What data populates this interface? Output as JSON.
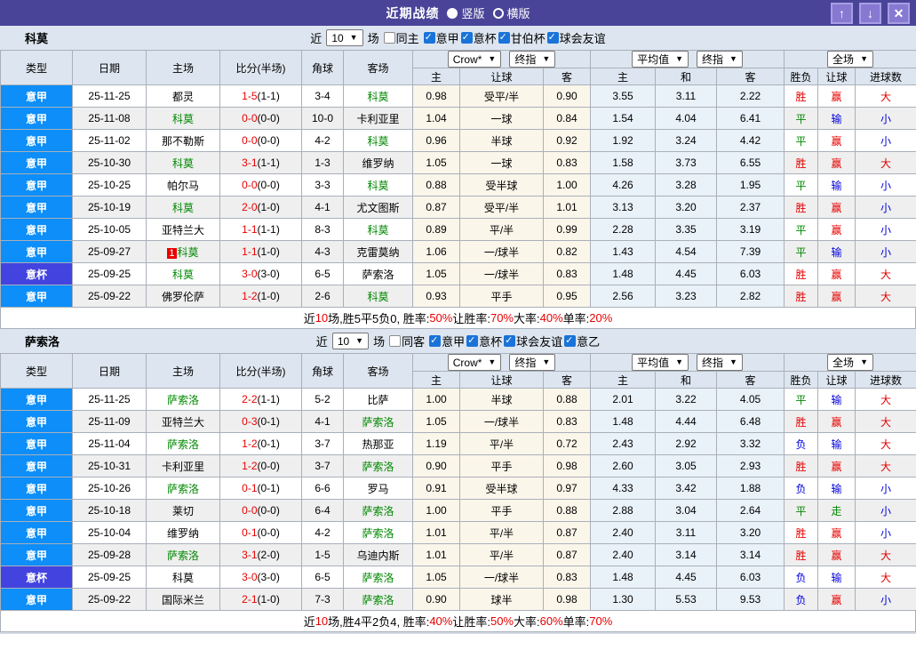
{
  "titlebar": {
    "title": "近期战绩",
    "layout_options": [
      {
        "label": "竖版",
        "selected": true
      },
      {
        "label": "横版",
        "selected": false
      }
    ],
    "icons": {
      "up": "↑",
      "down": "↓",
      "close": "✕"
    }
  },
  "controls": {
    "near_label": "近",
    "count": "10",
    "matches_label": "场"
  },
  "table_header": {
    "type": "类型",
    "date": "日期",
    "home": "主场",
    "score": "比分(半场)",
    "corner": "角球",
    "away": "客场",
    "ah": [
      "主",
      "让球",
      "客"
    ],
    "eu": [
      "主",
      "和",
      "客"
    ],
    "result": [
      "胜负",
      "让球",
      "进球数"
    ],
    "dropdowns": {
      "bookmaker": "Crow*",
      "final_ah": "终指",
      "average": "平均值",
      "final_eu": "终指",
      "scope": "全场"
    }
  },
  "league_colors": {
    "意甲": "#0d8ef8",
    "意杯": "#4343e0"
  },
  "result_colors": {
    "胜": "#e80000",
    "平": "#008800",
    "负": "#0000dd",
    "赢": "#e80000",
    "输": "#0000dd",
    "走": "#008800",
    "大": "#e80000",
    "小": "#0000dd"
  },
  "sections": [
    {
      "team": "科莫",
      "filter": {
        "same_label": "同主",
        "same_checked": false,
        "leagues": [
          {
            "label": "意甲",
            "checked": true
          },
          {
            "label": "意杯",
            "checked": true
          },
          {
            "label": "甘伯杯",
            "checked": true
          },
          {
            "label": "球会友谊",
            "checked": true
          }
        ]
      },
      "rows": [
        {
          "league": "意甲",
          "date": "25-11-25",
          "home": "都灵",
          "home_focus": false,
          "home_badge": "",
          "score": "1-5",
          "half": "(1-1)",
          "corner": "3-4",
          "away": "科莫",
          "away_focus": true,
          "ah": [
            "0.98",
            "受平/半",
            "0.90"
          ],
          "eu": [
            "3.55",
            "3.11",
            "2.22"
          ],
          "result": [
            "胜",
            "赢",
            "大"
          ]
        },
        {
          "league": "意甲",
          "date": "25-11-08",
          "home": "科莫",
          "home_focus": true,
          "home_badge": "",
          "score": "0-0",
          "half": "(0-0)",
          "corner": "10-0",
          "away": "卡利亚里",
          "away_focus": false,
          "ah": [
            "1.04",
            "一球",
            "0.84"
          ],
          "eu": [
            "1.54",
            "4.04",
            "6.41"
          ],
          "result": [
            "平",
            "输",
            "小"
          ]
        },
        {
          "league": "意甲",
          "date": "25-11-02",
          "home": "那不勒斯",
          "home_focus": false,
          "home_badge": "",
          "score": "0-0",
          "half": "(0-0)",
          "corner": "4-2",
          "away": "科莫",
          "away_focus": true,
          "ah": [
            "0.96",
            "半球",
            "0.92"
          ],
          "eu": [
            "1.92",
            "3.24",
            "4.42"
          ],
          "result": [
            "平",
            "赢",
            "小"
          ]
        },
        {
          "league": "意甲",
          "date": "25-10-30",
          "home": "科莫",
          "home_focus": true,
          "home_badge": "",
          "score": "3-1",
          "half": "(1-1)",
          "corner": "1-3",
          "away": "维罗纳",
          "away_focus": false,
          "ah": [
            "1.05",
            "一球",
            "0.83"
          ],
          "eu": [
            "1.58",
            "3.73",
            "6.55"
          ],
          "result": [
            "胜",
            "赢",
            "大"
          ]
        },
        {
          "league": "意甲",
          "date": "25-10-25",
          "home": "帕尔马",
          "home_focus": false,
          "home_badge": "",
          "score": "0-0",
          "half": "(0-0)",
          "corner": "3-3",
          "away": "科莫",
          "away_focus": true,
          "ah": [
            "0.88",
            "受半球",
            "1.00"
          ],
          "eu": [
            "4.26",
            "3.28",
            "1.95"
          ],
          "result": [
            "平",
            "输",
            "小"
          ]
        },
        {
          "league": "意甲",
          "date": "25-10-19",
          "home": "科莫",
          "home_focus": true,
          "home_badge": "",
          "score": "2-0",
          "half": "(1-0)",
          "corner": "4-1",
          "away": "尤文图斯",
          "away_focus": false,
          "ah": [
            "0.87",
            "受平/半",
            "1.01"
          ],
          "eu": [
            "3.13",
            "3.20",
            "2.37"
          ],
          "result": [
            "胜",
            "赢",
            "小"
          ]
        },
        {
          "league": "意甲",
          "date": "25-10-05",
          "home": "亚特兰大",
          "home_focus": false,
          "home_badge": "",
          "score": "1-1",
          "half": "(1-1)",
          "corner": "8-3",
          "away": "科莫",
          "away_focus": true,
          "ah": [
            "0.89",
            "平/半",
            "0.99"
          ],
          "eu": [
            "2.28",
            "3.35",
            "3.19"
          ],
          "result": [
            "平",
            "赢",
            "小"
          ]
        },
        {
          "league": "意甲",
          "date": "25-09-27",
          "home": "科莫",
          "home_focus": true,
          "home_badge": "1",
          "score": "1-1",
          "half": "(1-0)",
          "corner": "4-3",
          "away": "克雷莫纳",
          "away_focus": false,
          "ah": [
            "1.06",
            "一/球半",
            "0.82"
          ],
          "eu": [
            "1.43",
            "4.54",
            "7.39"
          ],
          "result": [
            "平",
            "输",
            "小"
          ]
        },
        {
          "league": "意杯",
          "date": "25-09-25",
          "home": "科莫",
          "home_focus": true,
          "home_badge": "",
          "score": "3-0",
          "half": "(3-0)",
          "corner": "6-5",
          "away": "萨索洛",
          "away_focus": false,
          "ah": [
            "1.05",
            "一/球半",
            "0.83"
          ],
          "eu": [
            "1.48",
            "4.45",
            "6.03"
          ],
          "result": [
            "胜",
            "赢",
            "大"
          ]
        },
        {
          "league": "意甲",
          "date": "25-09-22",
          "home": "佛罗伦萨",
          "home_focus": false,
          "home_badge": "",
          "score": "1-2",
          "half": "(1-0)",
          "corner": "2-6",
          "away": "科莫",
          "away_focus": true,
          "ah": [
            "0.93",
            "平手",
            "0.95"
          ],
          "eu": [
            "2.56",
            "3.23",
            "2.82"
          ],
          "result": [
            "胜",
            "赢",
            "大"
          ]
        }
      ],
      "summary": [
        {
          "text": "近",
          "red": false
        },
        {
          "text": "10",
          "red": true
        },
        {
          "text": "场,胜5平5负0, 胜率:",
          "red": false
        },
        {
          "text": "50%",
          "red": true
        },
        {
          "text": " 让胜率:",
          "red": false
        },
        {
          "text": "70%",
          "red": true
        },
        {
          "text": " 大率:",
          "red": false
        },
        {
          "text": "40%",
          "red": true
        },
        {
          "text": " 单率:",
          "red": false
        },
        {
          "text": "20%",
          "red": true
        }
      ]
    },
    {
      "team": "萨索洛",
      "filter": {
        "same_label": "同客",
        "same_checked": false,
        "leagues": [
          {
            "label": "意甲",
            "checked": true
          },
          {
            "label": "意杯",
            "checked": true
          },
          {
            "label": "球会友谊",
            "checked": true
          },
          {
            "label": "意乙",
            "checked": true
          }
        ]
      },
      "rows": [
        {
          "league": "意甲",
          "date": "25-11-25",
          "home": "萨索洛",
          "home_focus": true,
          "home_badge": "",
          "score": "2-2",
          "half": "(1-1)",
          "corner": "5-2",
          "away": "比萨",
          "away_focus": false,
          "ah": [
            "1.00",
            "半球",
            "0.88"
          ],
          "eu": [
            "2.01",
            "3.22",
            "4.05"
          ],
          "result": [
            "平",
            "输",
            "大"
          ]
        },
        {
          "league": "意甲",
          "date": "25-11-09",
          "home": "亚特兰大",
          "home_focus": false,
          "home_badge": "",
          "score": "0-3",
          "half": "(0-1)",
          "corner": "4-1",
          "away": "萨索洛",
          "away_focus": true,
          "ah": [
            "1.05",
            "一/球半",
            "0.83"
          ],
          "eu": [
            "1.48",
            "4.44",
            "6.48"
          ],
          "result": [
            "胜",
            "赢",
            "大"
          ]
        },
        {
          "league": "意甲",
          "date": "25-11-04",
          "home": "萨索洛",
          "home_focus": true,
          "home_badge": "",
          "score": "1-2",
          "half": "(0-1)",
          "corner": "3-7",
          "away": "热那亚",
          "away_focus": false,
          "ah": [
            "1.19",
            "平/半",
            "0.72"
          ],
          "eu": [
            "2.43",
            "2.92",
            "3.32"
          ],
          "result": [
            "负",
            "输",
            "大"
          ]
        },
        {
          "league": "意甲",
          "date": "25-10-31",
          "home": "卡利亚里",
          "home_focus": false,
          "home_badge": "",
          "score": "1-2",
          "half": "(0-0)",
          "corner": "3-7",
          "away": "萨索洛",
          "away_focus": true,
          "ah": [
            "0.90",
            "平手",
            "0.98"
          ],
          "eu": [
            "2.60",
            "3.05",
            "2.93"
          ],
          "result": [
            "胜",
            "赢",
            "大"
          ]
        },
        {
          "league": "意甲",
          "date": "25-10-26",
          "home": "萨索洛",
          "home_focus": true,
          "home_badge": "",
          "score": "0-1",
          "half": "(0-1)",
          "corner": "6-6",
          "away": "罗马",
          "away_focus": false,
          "ah": [
            "0.91",
            "受半球",
            "0.97"
          ],
          "eu": [
            "4.33",
            "3.42",
            "1.88"
          ],
          "result": [
            "负",
            "输",
            "小"
          ]
        },
        {
          "league": "意甲",
          "date": "25-10-18",
          "home": "莱切",
          "home_focus": false,
          "home_badge": "",
          "score": "0-0",
          "half": "(0-0)",
          "corner": "6-4",
          "away": "萨索洛",
          "away_focus": true,
          "ah": [
            "1.00",
            "平手",
            "0.88"
          ],
          "eu": [
            "2.88",
            "3.04",
            "2.64"
          ],
          "result": [
            "平",
            "走",
            "小"
          ]
        },
        {
          "league": "意甲",
          "date": "25-10-04",
          "home": "维罗纳",
          "home_focus": false,
          "home_badge": "",
          "score": "0-1",
          "half": "(0-0)",
          "corner": "4-2",
          "away": "萨索洛",
          "away_focus": true,
          "ah": [
            "1.01",
            "平/半",
            "0.87"
          ],
          "eu": [
            "2.40",
            "3.11",
            "3.20"
          ],
          "result": [
            "胜",
            "赢",
            "小"
          ]
        },
        {
          "league": "意甲",
          "date": "25-09-28",
          "home": "萨索洛",
          "home_focus": true,
          "home_badge": "",
          "score": "3-1",
          "half": "(2-0)",
          "corner": "1-5",
          "away": "乌迪内斯",
          "away_focus": false,
          "ah": [
            "1.01",
            "平/半",
            "0.87"
          ],
          "eu": [
            "2.40",
            "3.14",
            "3.14"
          ],
          "result": [
            "胜",
            "赢",
            "大"
          ]
        },
        {
          "league": "意杯",
          "date": "25-09-25",
          "home": "科莫",
          "home_focus": false,
          "home_badge": "",
          "score": "3-0",
          "half": "(3-0)",
          "corner": "6-5",
          "away": "萨索洛",
          "away_focus": true,
          "ah": [
            "1.05",
            "一/球半",
            "0.83"
          ],
          "eu": [
            "1.48",
            "4.45",
            "6.03"
          ],
          "result": [
            "负",
            "输",
            "大"
          ]
        },
        {
          "league": "意甲",
          "date": "25-09-22",
          "home": "国际米兰",
          "home_focus": false,
          "home_badge": "",
          "score": "2-1",
          "half": "(1-0)",
          "corner": "7-3",
          "away": "萨索洛",
          "away_focus": true,
          "ah": [
            "0.90",
            "球半",
            "0.98"
          ],
          "eu": [
            "1.30",
            "5.53",
            "9.53"
          ],
          "result": [
            "负",
            "赢",
            "小"
          ]
        }
      ],
      "summary": [
        {
          "text": "近",
          "red": false
        },
        {
          "text": "10",
          "red": true
        },
        {
          "text": "场,胜4平2负4, 胜率:",
          "red": false
        },
        {
          "text": "40%",
          "red": true
        },
        {
          "text": " 让胜率:",
          "red": false
        },
        {
          "text": "50%",
          "red": true
        },
        {
          "text": " 大率:",
          "red": false
        },
        {
          "text": "60%",
          "red": true
        },
        {
          "text": " 单率:",
          "red": false
        },
        {
          "text": "70%",
          "red": true
        }
      ]
    }
  ]
}
